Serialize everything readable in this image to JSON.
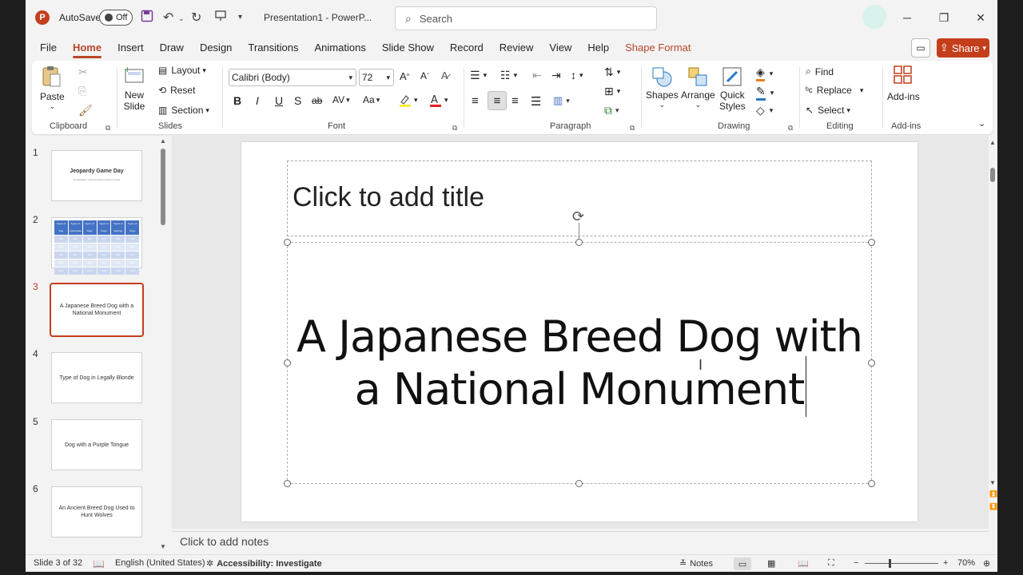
{
  "titlebar": {
    "app_initial": "P",
    "autosave_label": "AutoSave",
    "autosave_state": "Off",
    "doc_title": "Presentation1 - PowerP...",
    "search_placeholder": "Search"
  },
  "tabs": [
    {
      "label": "File"
    },
    {
      "label": "Home",
      "active": true
    },
    {
      "label": "Insert"
    },
    {
      "label": "Draw"
    },
    {
      "label": "Design"
    },
    {
      "label": "Transitions"
    },
    {
      "label": "Animations"
    },
    {
      "label": "Slide Show"
    },
    {
      "label": "Record"
    },
    {
      "label": "Review"
    },
    {
      "label": "View"
    },
    {
      "label": "Help"
    },
    {
      "label": "Shape Format",
      "accent": true
    }
  ],
  "share_label": "Share",
  "ribbon": {
    "clipboard": {
      "paste": "Paste",
      "label": "Clipboard"
    },
    "slides": {
      "new_slide_1": "New",
      "new_slide_2": "Slide",
      "layout": "Layout",
      "reset": "Reset",
      "section": "Section",
      "label": "Slides"
    },
    "font": {
      "font_name": "Calibri (Body)",
      "font_size": "72",
      "bold": "B",
      "italic": "I",
      "underline": "U",
      "shadow": "S",
      "strike": "ab",
      "spacing": "AV",
      "case": "Aa",
      "label": "Font"
    },
    "paragraph": {
      "label": "Paragraph"
    },
    "drawing": {
      "shapes": "Shapes",
      "arrange": "Arrange",
      "quick_styles_1": "Quick",
      "quick_styles_2": "Styles",
      "label": "Drawing"
    },
    "editing": {
      "find": "Find",
      "replace": "Replace",
      "select": "Select",
      "label": "Editing"
    },
    "addins": {
      "addins": "Add-ins",
      "label": "Add-ins"
    }
  },
  "slides": [
    {
      "num": "1",
      "title": "Jeopardy Game Day",
      "subtitle": "A celebration of the wonderful world of dogs"
    },
    {
      "num": "2",
      "table": true,
      "headers": [
        "Types of Dog",
        "Types of Appreciate",
        "Types of Dogs",
        "Types of Dogs",
        "Types of Sayings",
        "Types of Dogs"
      ],
      "rows": [
        [
          "200",
          "200",
          "200",
          "200",
          "200",
          "200"
        ],
        [
          "400",
          "400",
          "400",
          "400",
          "400",
          "400"
        ],
        [
          "600",
          "600",
          "600",
          "600",
          "600",
          "600"
        ],
        [
          "800",
          "800",
          "800",
          "800",
          "800",
          "800"
        ],
        [
          "1000",
          "1000",
          "1000",
          "1000",
          "1000",
          "1000"
        ]
      ]
    },
    {
      "num": "3",
      "title": "A Japanese Breed Dog with a National Monument",
      "active": true
    },
    {
      "num": "4",
      "title": "Type of Dog in Legally Blonde"
    },
    {
      "num": "5",
      "title": "Dog with a Purple Tongue"
    },
    {
      "num": "6",
      "title": "An Ancient Breed Dog Used to Hunt Wolves"
    }
  ],
  "canvas": {
    "title_placeholder": "Click to add title",
    "body_line1": "A Japanese Breed Dog with",
    "body_line2": "a National Monument"
  },
  "notes_placeholder": "Click to add notes",
  "status": {
    "slide_info": "Slide 3 of 32",
    "language": "English (United States)",
    "accessibility": "Accessibility: Investigate",
    "notes": "Notes",
    "zoom": "70%"
  },
  "colors": {
    "accent": "#c43e1c",
    "tab_accent": "#b7472a"
  }
}
